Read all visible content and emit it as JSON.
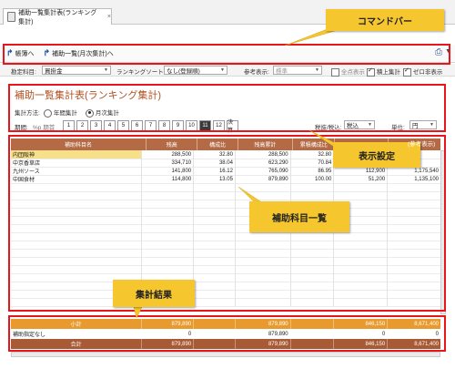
{
  "tab": {
    "title": "補助一覧集計表(ランキング集計)"
  },
  "callouts": {
    "command_bar": "コマンドバー",
    "display_settings": "表示設定",
    "account_list": "補助科目一覧",
    "totals": "集計結果"
  },
  "toolbar": {
    "btn1": "帳簿へ",
    "btn2": "補助一覧(月次集計)へ"
  },
  "filter": {
    "kanjo_label": "勘定科目:",
    "kanjo_value": "買掛金",
    "sort_label": "ランキングソート:",
    "sort_value": "なし(登録順)",
    "sanko_label": "参考表示:",
    "sanko_value": "標準",
    "chk_zero": "全点表示",
    "chk_kiage": "積上集計",
    "chk_zero_hide": "ゼロ非表示"
  },
  "report": {
    "title": "補助一覧集計表(ランキング集計)",
    "method_label": "集計方法:",
    "method_year": "年間集計",
    "method_month": "月次集計",
    "period_label": "期間:",
    "period_prefix": "%p 期首",
    "period_cells": [
      "1",
      "2",
      "3",
      "4",
      "5",
      "6",
      "7",
      "8",
      "9",
      "10",
      "11",
      "12",
      "決算"
    ],
    "tax_label": "税抜/税込:",
    "tax_value": "税込",
    "unit_label": "単位:",
    "unit_value": "円",
    "ref_label": "(参考表示)"
  },
  "grid": {
    "headers": [
      "補助科目名",
      "残高",
      "構成比",
      "残高累計",
      "累積構成比",
      "",
      ""
    ],
    "rows": [
      [
        "内団阪神",
        "288,500",
        "32.80",
        "288,500",
        "32.80",
        "",
        ""
      ],
      [
        "中京香草店",
        "334,710",
        "38.04",
        "623,290",
        "70.84",
        "",
        ""
      ],
      [
        "九州ソース",
        "141,800",
        "16.12",
        "765,090",
        "86.95",
        "112,900",
        "1,175,540"
      ],
      [
        "中国食材",
        "114,800",
        "13.05",
        "879,890",
        "100.00",
        "51,200",
        "1,135,100"
      ]
    ]
  },
  "totals": {
    "subtotal": [
      "小計",
      "879,890",
      "",
      "879,890",
      "",
      "846,150",
      "8,671,400"
    ],
    "unspecified": [
      "補助指定なし",
      "0",
      "",
      "879,890",
      "",
      "0",
      "0"
    ],
    "grand": [
      "合計",
      "879,890",
      "",
      "879,890",
      "",
      "846,150",
      "8,671,400"
    ]
  },
  "colors": {
    "accent": "#b46b45",
    "subtotal_bg": "#e89a2e",
    "grand_bg": "#a85a34",
    "callout_bg": "#f6c62e",
    "highlight_red": "#e8151b"
  }
}
